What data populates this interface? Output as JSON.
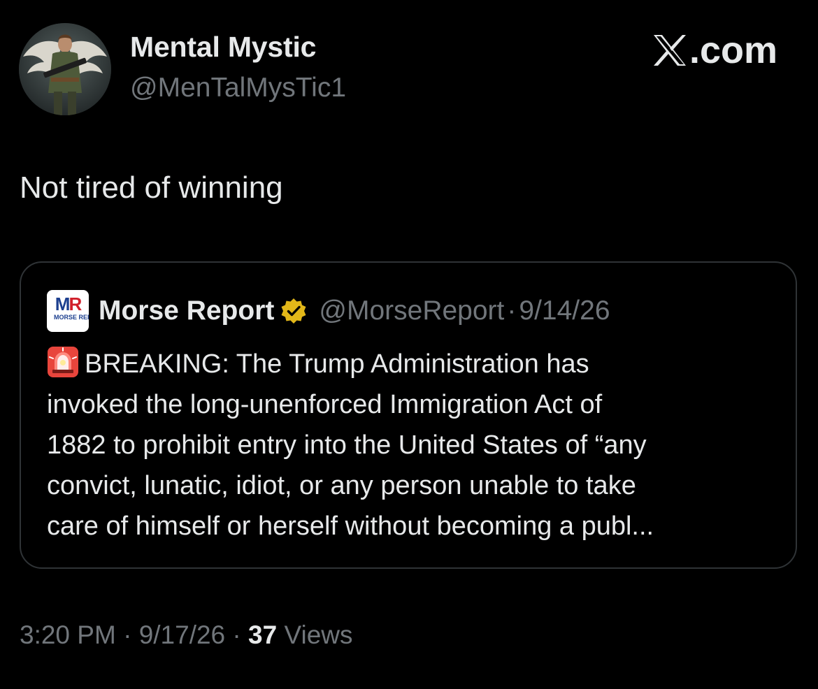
{
  "author": {
    "display_name": "Mental Mystic",
    "handle": "@MenTalMysTic1",
    "avatar_icon": "angel-soldier-avatar"
  },
  "watermark": {
    "icon": "x-logo-icon",
    "text": ".com"
  },
  "tweet": {
    "text": "Not tired of winning"
  },
  "quoted_tweet": {
    "logo": {
      "icon": "morse-report-logo",
      "mark_left": "M",
      "mark_right": "R",
      "wordmark": "MORSE REPORT"
    },
    "name": "Morse Report",
    "verified_icon": "verified-gold-badge-icon",
    "handle": "@MorseReport",
    "separator": "·",
    "date": "9/14/26",
    "emoji_icon": "police-siren-icon",
    "lines": [
      "BREAKING: The Trump Administration has",
      "invoked the long-unenforced Immigration Act of",
      "1882 to prohibit entry into the United States of “any",
      "convict, lunatic, idiot, or any person unable to take",
      "care of himself or herself without becoming a publ..."
    ]
  },
  "meta": {
    "time": "3:20 PM",
    "sep1": " · ",
    "date": "9/17/26",
    "sep2": " · ",
    "views_count": "37",
    "views_label": " Views"
  },
  "colors": {
    "background": "#000000",
    "primary_text": "#e7e9ea",
    "secondary_text": "#71767b",
    "border": "#2f3336",
    "verified_gold": "#e2b719",
    "logo_blue": "#1c3f8f",
    "logo_red": "#d0202b"
  }
}
